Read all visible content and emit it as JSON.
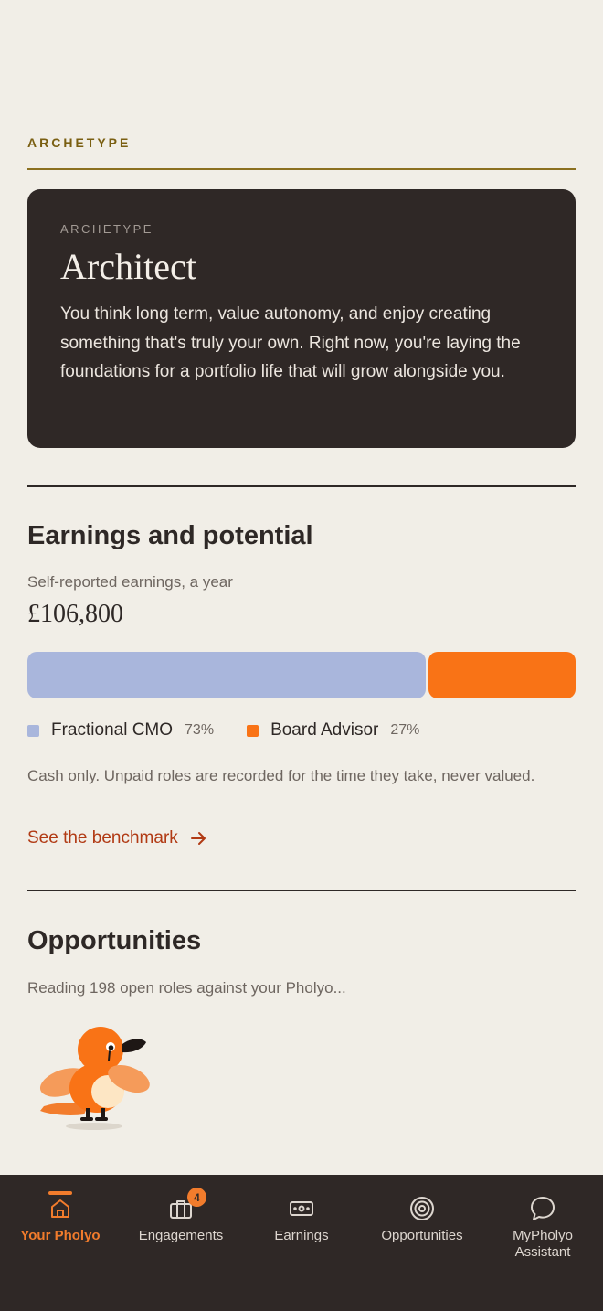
{
  "archetype_section": {
    "eyebrow": "ARCHETYPE",
    "card_label": "ARCHETYPE",
    "title": "Architect",
    "description": "You think long term, value autonomy, and enjoy creating something that's truly your own. Right now, you're laying the foundations for a portfolio life that will grow alongside you."
  },
  "earnings": {
    "heading": "Earnings and potential",
    "subtitle": "Self-reported earnings, a year",
    "amount": "£106,800",
    "chart_data": {
      "type": "bar",
      "categories": [
        "Fractional CMO",
        "Board Advisor"
      ],
      "values": [
        73,
        27
      ],
      "colors": [
        "#a9b6dc",
        "#f97316"
      ]
    },
    "legend": [
      {
        "label": "Fractional CMO",
        "pct": "73%",
        "color": "#a9b6dc"
      },
      {
        "label": "Board Advisor",
        "pct": "27%",
        "color": "#f97316"
      }
    ],
    "note": "Cash only. Unpaid roles are recorded for the time they take, never valued.",
    "link_label": "See the benchmark"
  },
  "opportunities": {
    "heading": "Opportunities",
    "status": "Reading 198 open roles against your Pholyo..."
  },
  "nav": {
    "tabs": [
      {
        "label": "Your Pholyo",
        "icon": "home-icon",
        "active": true
      },
      {
        "label": "Engagements",
        "icon": "briefcase-icon",
        "badge": "4"
      },
      {
        "label": "Earnings",
        "icon": "cash-icon"
      },
      {
        "label": "Opportunities",
        "icon": "target-icon"
      },
      {
        "label": "MyPholyo Assistant",
        "icon": "chat-icon"
      }
    ]
  },
  "colors": {
    "background": "#f1eee7",
    "card": "#2f2826",
    "accent": "#f27c2c",
    "link": "#b13a14",
    "eyebrow": "#7a5f12"
  }
}
